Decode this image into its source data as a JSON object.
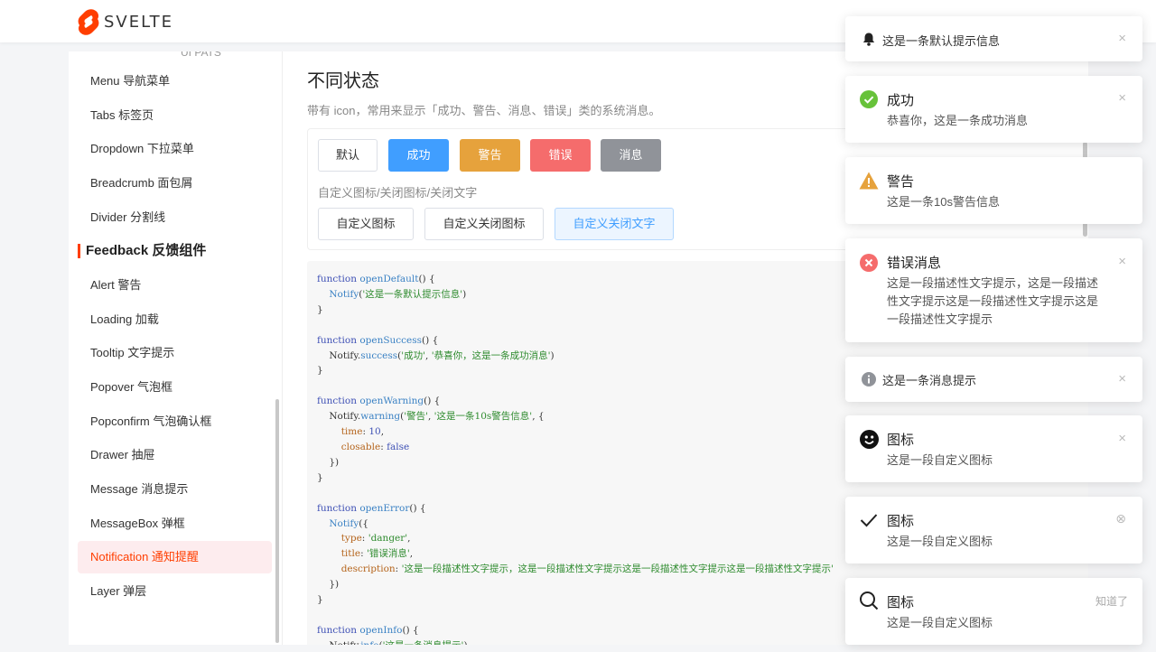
{
  "header": {
    "logo_text": "SVELTE"
  },
  "sidebar": {
    "cut_item": "UI PATS",
    "items_top": [
      "Menu 导航菜单",
      "Tabs 标签页",
      "Dropdown 下拉菜单",
      "Breadcrumb 面包屑",
      "Divider 分割线"
    ],
    "group_label": "Feedback 反馈组件",
    "items_feedback": [
      "Alert 警告",
      "Loading 加载",
      "Tooltip 文字提示",
      "Popover 气泡框",
      "Popconfirm 气泡确认框",
      "Drawer 抽屉",
      "Message 消息提示",
      "MessageBox 弹框",
      "Notification 通知提醒",
      "Layer 弹层"
    ],
    "active_item": "Notification 通知提醒"
  },
  "main": {
    "title": "不同状态",
    "description": "带有 icon，常用来显示「成功、警告、消息、错误」类的系统消息。",
    "buttons": [
      "默认",
      "成功",
      "警告",
      "错误",
      "消息"
    ],
    "sub_label": "自定义图标/关闭图标/关闭文字",
    "custom_buttons": [
      "自定义图标",
      "自定义关闭图标",
      "自定义关闭文字"
    ]
  },
  "colors": {
    "accent": "#ff3e00",
    "success": "#67c23a",
    "warning": "#e6a23c",
    "danger": "#f56c6c",
    "info": "#909399",
    "primary": "#409eff"
  },
  "notifications": [
    {
      "type": "default",
      "icon": "bell-icon",
      "text": "这是一条默认提示信息",
      "close": "×"
    },
    {
      "type": "success",
      "icon": "check-circle-icon",
      "title": "成功",
      "description": "恭喜你，这是一条成功消息",
      "close": "×"
    },
    {
      "type": "warning",
      "icon": "warning-triangle-icon",
      "title": "警告",
      "description": "这是一条10s警告信息"
    },
    {
      "type": "danger",
      "icon": "close-circle-icon",
      "title": "错误消息",
      "description": "这是一段描述性文字提示，这是一段描述性文字提示这是一段描述性文字提示这是一段描述性文字提示",
      "close": "×"
    },
    {
      "type": "info",
      "icon": "info-circle-icon",
      "text": "这是一条消息提示",
      "close": "×"
    },
    {
      "type": "custom",
      "icon": "smiley-icon",
      "title": "图标",
      "description": "这是一段自定义图标",
      "close": "×"
    },
    {
      "type": "custom",
      "icon": "checkmark-icon",
      "title": "图标",
      "description": "这是一段自定义图标",
      "close": "⊗"
    },
    {
      "type": "custom",
      "icon": "search-icon",
      "title": "图标",
      "description": "这是一段自定义图标",
      "close_text": "知道了"
    }
  ]
}
